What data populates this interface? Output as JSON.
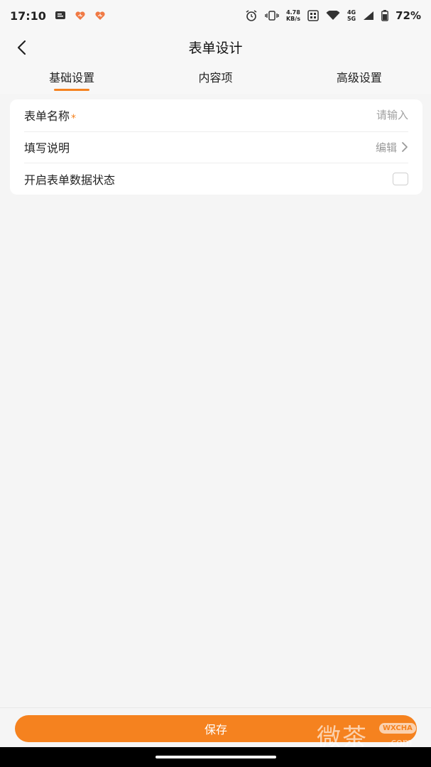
{
  "status_bar": {
    "time": "17:10",
    "net_speed_value": "4.78",
    "net_speed_unit": "KB/s",
    "net_gen_top": "4G",
    "net_gen_bottom": "5G",
    "battery_percent": "72%"
  },
  "nav": {
    "title": "表单设计"
  },
  "tabs": [
    {
      "label": "基础设置",
      "active": true
    },
    {
      "label": "内容项",
      "active": false
    },
    {
      "label": "高级设置",
      "active": false
    }
  ],
  "form": {
    "name_label": "表单名称",
    "name_required": "*",
    "name_placeholder": "请输入",
    "description_label": "填写说明",
    "description_action": "编辑",
    "status_label": "开启表单数据状态"
  },
  "footer": {
    "save_label": "保存"
  },
  "watermark": {
    "chinese": "微茶",
    "badge": "WXCHA",
    "domain": ".com"
  },
  "colors": {
    "accent": "#f5821f",
    "background": "#f5f5f5",
    "card": "#ffffff"
  }
}
